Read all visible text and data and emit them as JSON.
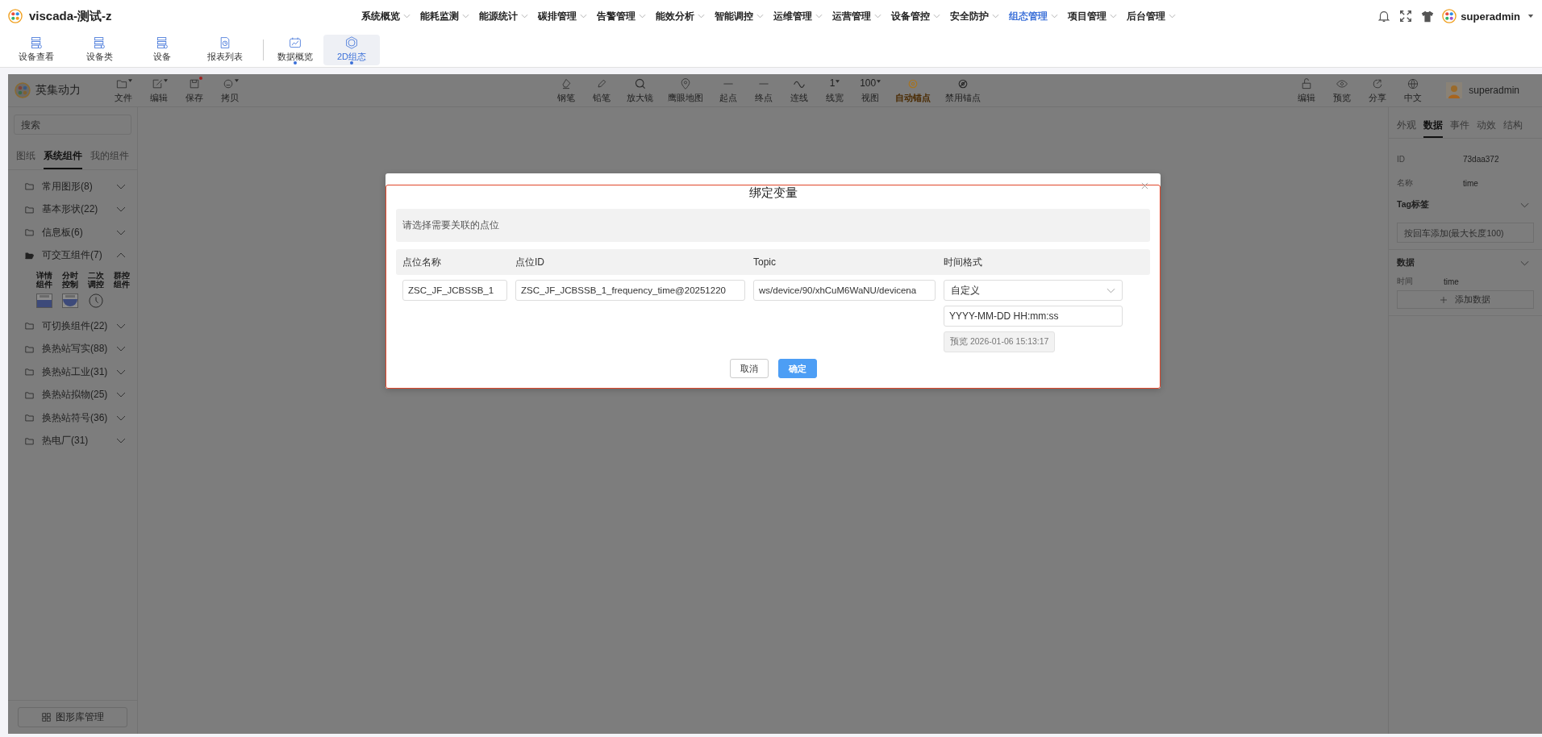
{
  "app": {
    "title": "viscada-测试-z",
    "user": "superadmin"
  },
  "nav": [
    {
      "label": "系统概览",
      "selected": false
    },
    {
      "label": "能耗监测",
      "selected": false
    },
    {
      "label": "能源统计",
      "selected": false
    },
    {
      "label": "碳排管理",
      "selected": false
    },
    {
      "label": "告警管理",
      "selected": false
    },
    {
      "label": "能效分析",
      "selected": false
    },
    {
      "label": "智能调控",
      "selected": false
    },
    {
      "label": "运维管理",
      "selected": false
    },
    {
      "label": "运营管理",
      "selected": false
    },
    {
      "label": "设备管控",
      "selected": false
    },
    {
      "label": "安全防护",
      "selected": false
    },
    {
      "label": "组态管理",
      "selected": true
    },
    {
      "label": "项目管理",
      "selected": false
    },
    {
      "label": "后台管理",
      "selected": false
    }
  ],
  "quick_tabs": [
    {
      "label": "设备查看",
      "kind": "server",
      "dot": false,
      "selected": false
    },
    {
      "label": "设备类",
      "kind": "server",
      "dot": false,
      "selected": false
    },
    {
      "label": "设备",
      "kind": "server",
      "dot": false,
      "selected": false
    },
    {
      "label": "报表列表",
      "kind": "report",
      "dot": false,
      "selected": false
    },
    {
      "label": "数据概览",
      "kind": "chart",
      "dot": true,
      "selected": false
    },
    {
      "label": "2D组态",
      "kind": "twod",
      "dot": true,
      "selected": true
    }
  ],
  "editor": {
    "brand": "英集动力",
    "user": "superadmin",
    "file_tools": [
      {
        "label": "文件",
        "kind": "file",
        "dropdown": true,
        "badge": false
      },
      {
        "label": "编辑",
        "kind": "edit",
        "dropdown": true,
        "badge": false
      },
      {
        "label": "保存",
        "kind": "save",
        "dropdown": false,
        "badge": true
      },
      {
        "label": "拷贝",
        "kind": "copy",
        "dropdown": true,
        "badge": false
      }
    ],
    "draw_tools": [
      {
        "label": "钢笔",
        "kind": "pen",
        "selected": false
      },
      {
        "label": "铅笔",
        "kind": "pencil",
        "selected": false
      },
      {
        "label": "放大镜",
        "kind": "search",
        "selected": false
      },
      {
        "label": "鹰眼地图",
        "kind": "pin",
        "selected": false
      },
      {
        "label": "起点",
        "kind": "line",
        "selected": false
      },
      {
        "label": "终点",
        "kind": "line",
        "selected": false
      },
      {
        "label": "连线",
        "kind": "wave",
        "selected": false
      },
      {
        "label": "线宽",
        "kind": "value",
        "value": "1",
        "selected": false
      },
      {
        "label": "视图",
        "kind": "value",
        "value": "100",
        "selected": false
      },
      {
        "label": "自动锚点",
        "kind": "target",
        "selected": true
      },
      {
        "label": "禁用锚点",
        "kind": "disabled",
        "selected": false
      }
    ],
    "right_tools": [
      {
        "label": "编辑",
        "kind": "lock"
      },
      {
        "label": "预览",
        "kind": "eye"
      },
      {
        "label": "分享",
        "kind": "share"
      },
      {
        "label": "中文",
        "kind": "globe"
      }
    ]
  },
  "sidebar": {
    "search": {
      "placeholder": "搜索"
    },
    "tabs": [
      {
        "label": "图纸",
        "selected": false
      },
      {
        "label": "系统组件",
        "selected": true
      },
      {
        "label": "我的组件",
        "selected": false
      }
    ],
    "categories": [
      {
        "label": "常用图形(8)",
        "expanded": false
      },
      {
        "label": "基本形状(22)",
        "expanded": false
      },
      {
        "label": "信息板(6)",
        "expanded": false
      },
      {
        "label": "可交互组件(7)",
        "expanded": true,
        "components": [
          {
            "label": "详情组件"
          },
          {
            "label": "分时控制"
          },
          {
            "label": "二次调控"
          },
          {
            "label": "群控组件"
          }
        ]
      },
      {
        "label": "可切换组件(22)",
        "expanded": false
      },
      {
        "label": "换热站写实(88)",
        "expanded": false
      },
      {
        "label": "换热站工业(31)",
        "expanded": false
      },
      {
        "label": "换热站拟物(25)",
        "expanded": false
      },
      {
        "label": "换热站符号(36)",
        "expanded": false
      },
      {
        "label": "热电厂(31)",
        "expanded": false
      }
    ],
    "manage_button": "图形库管理"
  },
  "dialog": {
    "title": "绑定变量",
    "hint": "请选择需要关联的点位",
    "columns": [
      "点位名称",
      "点位ID",
      "Topic",
      "时间格式"
    ],
    "row": {
      "name": "ZSC_JF_JCBSSB_1",
      "point_id": "ZSC_JF_JCBSSB_1_frequency_time@20251220",
      "topic": "ws/device/90/xhCuM6WaNU/devicena",
      "time_format": "自定义",
      "pattern": "YYYY-MM-DD HH:mm:ss",
      "preview": "预览 2026-01-06 15:13:17"
    },
    "buttons": [
      {
        "label": "取消",
        "kind": "secondary"
      },
      {
        "label": "确定",
        "kind": "primary"
      }
    ]
  },
  "properties": {
    "tabs": [
      {
        "label": "外观",
        "selected": false
      },
      {
        "label": "数据",
        "selected": true
      },
      {
        "label": "事件",
        "selected": false
      },
      {
        "label": "动效",
        "selected": false
      },
      {
        "label": "结构",
        "selected": false
      }
    ],
    "fields": [
      {
        "label": "ID",
        "value": "73daa372"
      },
      {
        "label": "名称",
        "value": "time"
      }
    ],
    "tag_section": {
      "title": "Tag标签",
      "expanded": true,
      "placeholder": "按回车添加(最大长度100)"
    },
    "data_section": {
      "title": "数据",
      "expanded": true,
      "rows": [
        {
          "label": "时间",
          "value": "time"
        }
      ],
      "add_button": "添加数据"
    }
  }
}
